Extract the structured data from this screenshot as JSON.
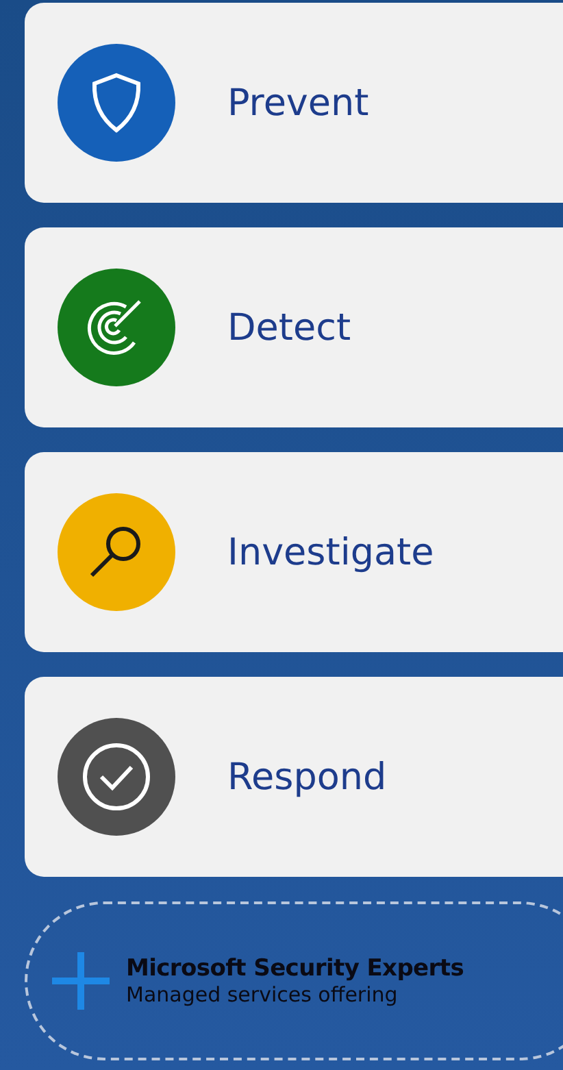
{
  "steps": [
    {
      "kind": "shield",
      "label": "Prevent",
      "color": "#1560b8"
    },
    {
      "kind": "target",
      "label": "Detect",
      "color": "#157a1c"
    },
    {
      "kind": "magnifier",
      "label": "Investigate",
      "color": "#f0b000"
    },
    {
      "kind": "check",
      "label": "Respond",
      "color": "#505050"
    }
  ],
  "addon": {
    "title": "Microsoft Security Experts",
    "subtitle": "Managed services offering"
  }
}
